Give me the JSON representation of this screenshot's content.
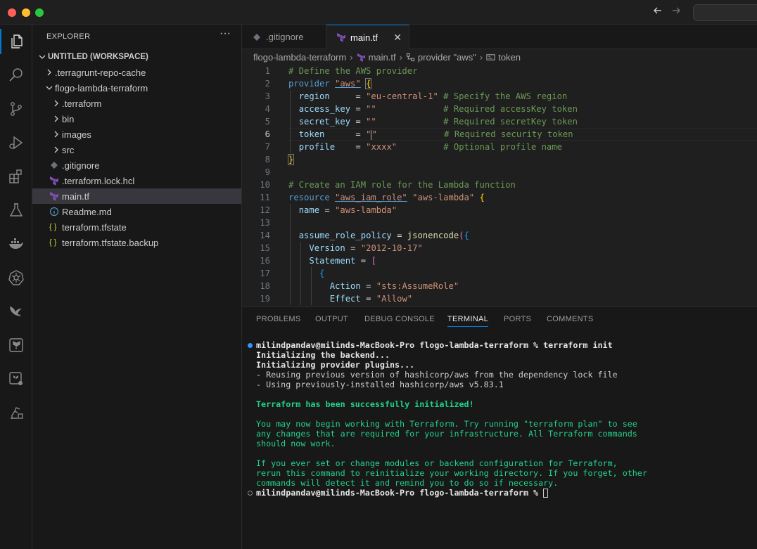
{
  "sidebar": {
    "header": "EXPLORER",
    "more": "···",
    "workspace": "UNTITLED (WORKSPACE)",
    "items": [
      {
        "label": ".terragrunt-repo-cache"
      },
      {
        "label": "flogo-lambda-terraform"
      },
      {
        "label": ".terraform"
      },
      {
        "label": "bin"
      },
      {
        "label": "images"
      },
      {
        "label": "src"
      },
      {
        "label": ".gitignore"
      },
      {
        "label": ".terraform.lock.hcl"
      },
      {
        "label": "main.tf"
      },
      {
        "label": "Readme.md"
      },
      {
        "label": "terraform.tfstate"
      },
      {
        "label": "terraform.tfstate.backup"
      }
    ]
  },
  "tabs": [
    {
      "label": ".gitignore"
    },
    {
      "label": "main.tf"
    }
  ],
  "breadcrumb": [
    "flogo-lambda-terraform",
    "main.tf",
    "provider \"aws\"",
    "token"
  ],
  "editor": {
    "line_numbers": [
      "1",
      "2",
      "3",
      "4",
      "5",
      "6",
      "7",
      "8",
      "9",
      "10",
      "11",
      "12",
      "13",
      "14",
      "15",
      "16",
      "17",
      "18",
      "19"
    ],
    "current_line": 6
  },
  "panel": {
    "tabs": [
      "PROBLEMS",
      "OUTPUT",
      "DEBUG CONSOLE",
      "TERMINAL",
      "PORTS",
      "COMMENTS"
    ],
    "active_tab": "TERMINAL",
    "terminal": [
      "milindpandav@milinds-MacBook-Pro flogo-lambda-terraform % terraform init",
      "Initializing the backend...",
      "Initializing provider plugins...",
      "- Reusing previous version of hashicorp/aws from the dependency lock file",
      "- Using previously-installed hashicorp/aws v5.83.1",
      "Terraform has been successfully initialized!",
      "You may now begin working with Terraform. Try running \"terraform plan\" to see",
      "any changes that are required for your infrastructure. All Terraform commands",
      "should now work.",
      "If you ever set or change modules or backend configuration for Terraform,",
      "rerun this command to reinitialize your working directory. If you forget, other",
      "commands will detect it and remind you to do so if necessary.",
      "milindpandav@milinds-MacBook-Pro flogo-lambda-terraform % "
    ]
  },
  "colors": {
    "accent": "#0078d4",
    "terraform": "#844fba",
    "success": "#23d18b"
  }
}
